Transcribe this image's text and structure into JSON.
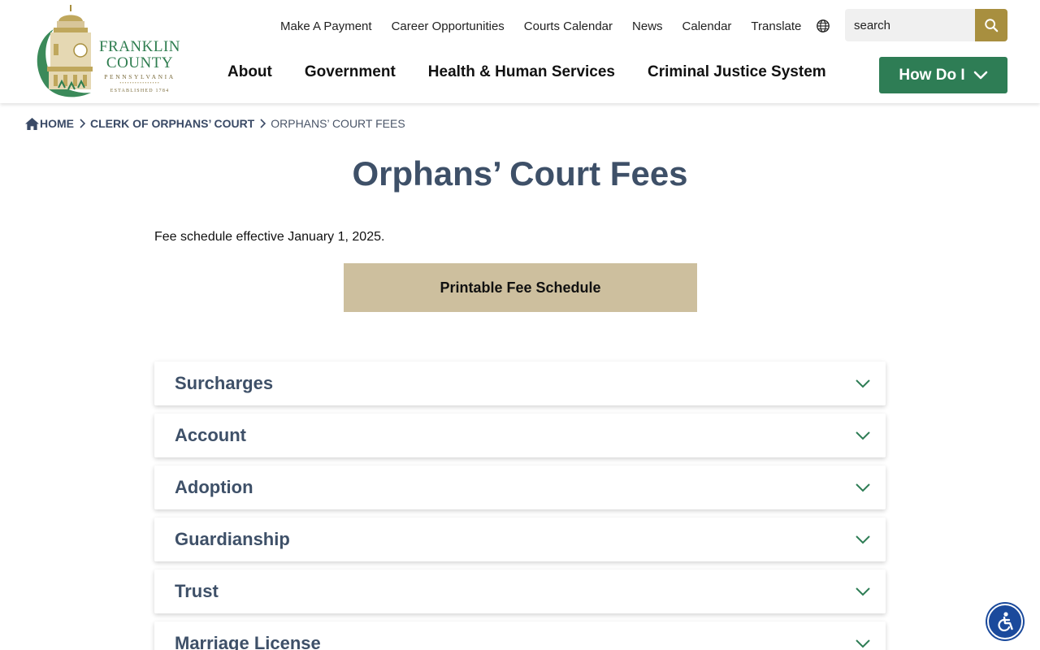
{
  "logo": {
    "line1": "FRANKLIN",
    "line2": "COUNTY",
    "line3": "PENNSYLVANIA",
    "line4": "ESTABLISHED 1784"
  },
  "utility_nav": [
    "Make A Payment",
    "Career Opportunities",
    "Courts Calendar",
    "News",
    "Calendar",
    "Translate"
  ],
  "search": {
    "placeholder": "search"
  },
  "main_nav": [
    "About",
    "Government",
    "Health & Human Services",
    "Criminal Justice System"
  ],
  "how_do_i": "How Do I",
  "breadcrumb": {
    "home": "HOME",
    "parent": "CLERK OF ORPHANS’ COURT",
    "current": "ORPHANS’ COURT FEES"
  },
  "page_title": "Orphans’ Court Fees",
  "intro": "Fee schedule effective January 1, 2025.",
  "print_button": "Printable Fee Schedule",
  "accordion": [
    "Surcharges",
    "Account",
    "Adoption",
    "Guardianship",
    "Trust",
    "Marriage License"
  ],
  "colors": {
    "brand_green": "#2e7d55",
    "gold": "#a88f3f",
    "tan_button": "#cdbf9e",
    "heading": "#3e5068",
    "accessibility_blue": "#1b4a9c"
  }
}
